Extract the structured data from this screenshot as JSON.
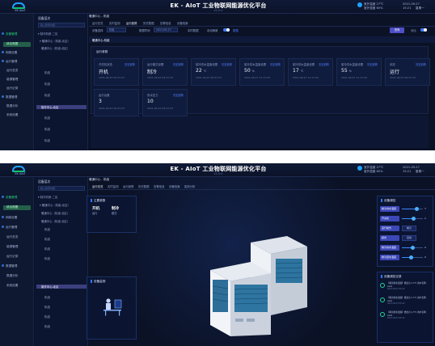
{
  "app": {
    "logo_text": "EK AIoT",
    "title": "EK - AIoT 工业物联网能源优化平台",
    "subtitle": "v1.0.0",
    "weather": {
      "temp": "室外温度 27℃",
      "humidity": "室外湿度 60%",
      "date": "2021-09-27",
      "time": "15:21",
      "weekday": "星期一"
    }
  },
  "sidebar": {
    "items": [
      {
        "label": "设备管理"
      },
      {
        "label": "综合视图"
      },
      {
        "label": "网络设置"
      },
      {
        "label": "运行管理"
      },
      {
        "label": "运行总览"
      },
      {
        "label": "能源管理"
      },
      {
        "label": "运行记录"
      },
      {
        "label": "数据管理"
      },
      {
        "label": "数据分析"
      },
      {
        "label": "系统设置"
      }
    ]
  },
  "tree": {
    "header": "设备层次",
    "search_placeholder": "输入搜索内容",
    "items": [
      {
        "label": "▾ 制冷机房-二区"
      },
      {
        "label": "▾ 暖通中心（机组-北区）"
      },
      {
        "label": "暖通中心（机组-北区）"
      },
      {
        "label": "机组"
      },
      {
        "label": "机组"
      },
      {
        "label": "机组"
      },
      {
        "label": "机组"
      },
      {
        "label": "制冷中心-北区"
      },
      {
        "label": "机组"
      },
      {
        "label": "机组"
      },
      {
        "label": "机组"
      },
      {
        "label": "机组"
      }
    ]
  },
  "screen1": {
    "breadcrumb": "暖通中心 - 机组",
    "tabs": [
      "运行总览",
      "实时监测",
      "运行趋势",
      "历史数据",
      "告警信息",
      "设备档案"
    ],
    "filter": {
      "label_device": "设备选择",
      "device_value": "机组",
      "label_time": "数据时间",
      "time_value": "2021-09-27",
      "label_auto": "实时数据",
      "label_switch": "自动刷新",
      "link": "数据",
      "query_btn": "查询",
      "compare_label": "对比"
    },
    "strip_label": "暖通中心-机组",
    "panel_title": "运行参数",
    "cards": [
      {
        "label": "开关机状态",
        "link": "历史趋势",
        "value": "开机",
        "unit": "",
        "time": "2021-09-27 09:37:23"
      },
      {
        "label": "运行模式设置",
        "link": "历史趋势",
        "value": "制冷",
        "unit": "",
        "time": "2021-09-27 09:37:23"
      },
      {
        "label": "制冷供水温度设置",
        "link": "历史趋势",
        "value": "22",
        "unit": "℃",
        "time": "2021-09-27 09:37:23"
      },
      {
        "label": "制冷供水温度设置",
        "link": "历史趋势",
        "value": "50",
        "unit": "%",
        "time": "2021-09-27 11:17:20"
      },
      {
        "label": "制冷供水温度设置",
        "link": "历史趋势",
        "value": "17",
        "unit": "℃",
        "time": "2021-09-27 11:17:20"
      },
      {
        "label": "制冷供水温度设置",
        "link": "历史趋势",
        "value": "55",
        "unit": "%",
        "time": "2021-09-27 11:17:20"
      },
      {
        "label": "状态",
        "link": "历史趋势",
        "value": "运行",
        "unit": "",
        "time": "2021-09-27 09:37:23"
      },
      {
        "label": "运行台数",
        "link": "",
        "value": "3",
        "unit": "",
        "time": "2021-09-27 09:37:23"
      },
      {
        "label": "供水压力",
        "link": "历史趋势",
        "value": "10",
        "unit": "",
        "time": "2021-09-27 09:37:23"
      }
    ]
  },
  "screen2": {
    "breadcrumb": "暖通中心 - 机组",
    "tabs": [
      "运行总览",
      "实时监测",
      "运行趋势",
      "历史数据",
      "告警信息",
      "设备档案",
      "能效分析"
    ],
    "status_panel": {
      "title": "主要参数",
      "items": [
        {
          "k": "运行",
          "v": "开机"
        },
        {
          "k": "模式",
          "v": "制冷"
        }
      ]
    },
    "env_panel": {
      "title": "设备监测"
    },
    "control_panel": {
      "title": "设备调控",
      "rows": [
        {
          "label": "制冷供水温度",
          "type": "slider",
          "value": "7",
          "fill": 0.7
        },
        {
          "label": "开关机",
          "type": "slider",
          "value": "1",
          "fill": 0.55
        },
        {
          "label": "运行模式",
          "type": "box",
          "value": "制冷"
        },
        {
          "label": "模式",
          "type": "box",
          "value": "自动"
        },
        {
          "label": "制冷供水温度",
          "type": "slider",
          "value": "2",
          "fill": 0.5
        },
        {
          "label": "制冷回水温度",
          "type": "slider",
          "value": "2",
          "fill": 0.45
        }
      ]
    },
    "log_panel": {
      "title": "设备调控记录",
      "items": [
        {
          "text": "【制冷供水温度】修改为 1.7℃ 用户名称：xxxx",
          "time": "2021-09-27 09:12"
        },
        {
          "text": "【制冷供水温度】修改为 1.7℃ 用户名称：xxxx",
          "time": "2021-09-27 09:12"
        },
        {
          "text": "【制冷供水温度】修改为 1.7℃ 用户名称：xxxx",
          "time": "2021-09-27 09:12"
        }
      ]
    }
  }
}
